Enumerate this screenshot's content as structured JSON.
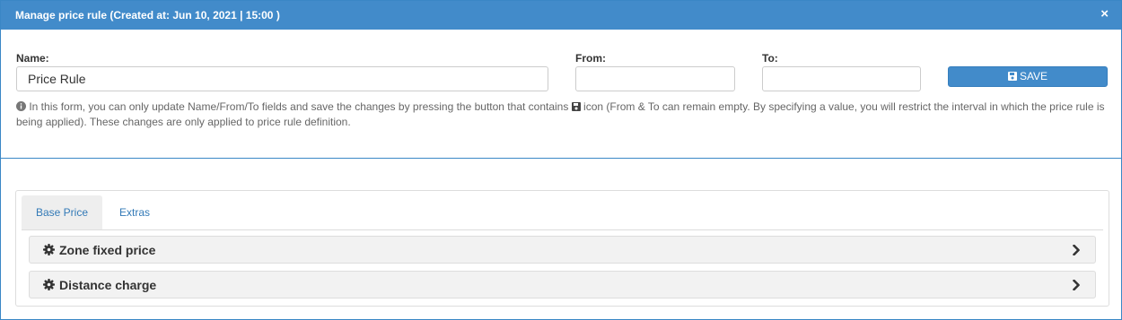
{
  "modal": {
    "title": "Manage price rule (Created at: Jun 10, 2021 | 15:00 )",
    "close_label": "×"
  },
  "form": {
    "name_label": "Name:",
    "name_value": "Price Rule",
    "from_label": "From:",
    "from_value": "",
    "to_label": "To:",
    "to_value": "",
    "save_label": "SAVE",
    "help_part1": "In this form, you can only update Name/From/To fields and save the changes by pressing the button that contains",
    "help_part2": "icon (From & To can remain empty. By specifying a value, you will restrict the interval in which the price rule is being applied). These changes are only applied to price rule definition."
  },
  "tabs": [
    {
      "label": "Base Price",
      "active": true
    },
    {
      "label": "Extras",
      "active": false
    }
  ],
  "accordion": [
    {
      "label": "Zone fixed price",
      "icon": "gear-icon"
    },
    {
      "label": "Distance charge",
      "icon": "gear-icon"
    }
  ],
  "colors": {
    "header_bg": "#428bca",
    "link": "#337ab7",
    "panel_heading_bg": "#f2f2f2"
  }
}
